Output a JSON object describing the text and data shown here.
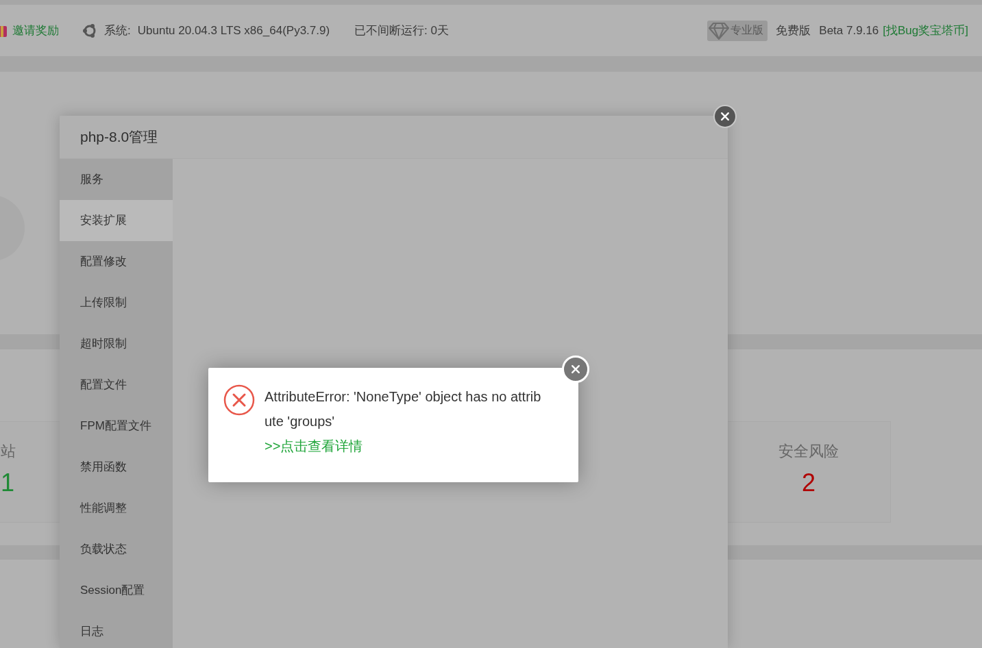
{
  "header": {
    "invite_link": "邀请奖励",
    "system_label": "系统:",
    "system_value": "Ubuntu 20.04.3 LTS x86_64(Py3.7.9)",
    "uptime": "已不间断运行: 0天",
    "pro_badge": "专业版",
    "edition": "免费版",
    "version": "Beta 7.9.16",
    "bug_bounty_link": "[找Bug奖宝塔币]"
  },
  "stat_cards": [
    {
      "label": "站",
      "value": "1",
      "color": "#1f8a35"
    },
    {
      "label": "安全风险",
      "value": "2",
      "color": "#b00000"
    }
  ],
  "modal": {
    "title": "php-8.0管理",
    "menu": [
      {
        "label": "服务",
        "selected": false
      },
      {
        "label": "安装扩展",
        "selected": true
      },
      {
        "label": "配置修改",
        "selected": false
      },
      {
        "label": "上传限制",
        "selected": false
      },
      {
        "label": "超时限制",
        "selected": false
      },
      {
        "label": "配置文件",
        "selected": false
      },
      {
        "label": "FPM配置文件",
        "selected": false
      },
      {
        "label": "禁用函数",
        "selected": false
      },
      {
        "label": "性能调整",
        "selected": false
      },
      {
        "label": "负载状态",
        "selected": false
      },
      {
        "label": "Session配置",
        "selected": false
      },
      {
        "label": "日志",
        "selected": false
      }
    ]
  },
  "error_dialog": {
    "message": "AttributeError: 'NoneType' object has no attribute 'groups'",
    "details_link": ">>点击查看详情"
  }
}
